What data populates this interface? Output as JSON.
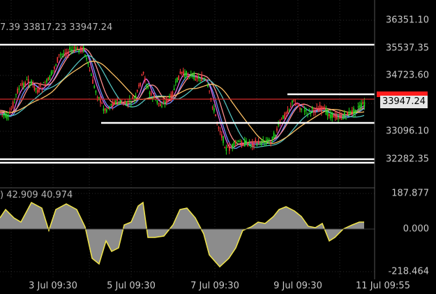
{
  "main_chart": {
    "info_values": "7.39 33817.23 33947.24",
    "price_axis": [
      "36351.10",
      "35537.35",
      "34723.60",
      "33096.10",
      "32282.35"
    ],
    "last_price": "33947.24",
    "colors": {
      "bull_candle": "#21e11b",
      "bear_candle": "#ff3a3a",
      "ma_fast": "#e46ae6",
      "ma_mid": "#ff8f8f",
      "ma_slow": "#ffc266",
      "ma_long": "#54c3bf",
      "ma_xlong": "#6a8cff",
      "level_line": "#ffffff",
      "price_line": "#d32a2a"
    }
  },
  "oscillator": {
    "info_values": ") 42.909 40.974",
    "axis": [
      "187.877",
      "0.000",
      "-218.464"
    ],
    "colors": {
      "fill": "#8c8c8c",
      "line": "#f2e64a"
    }
  },
  "time_axis": [
    "3 Jul 09:30",
    "5 Jul 09:30",
    "7 Jul 09:30",
    "9 Jul 09:30",
    "11 Jul 09:55"
  ]
}
